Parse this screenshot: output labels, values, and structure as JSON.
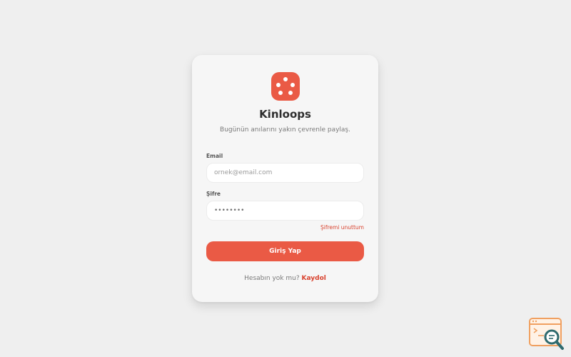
{
  "app": {
    "name": "Kinloops",
    "tagline": "Bugünün anılarını yakın çevrenle paylaş."
  },
  "form": {
    "email_label": "Email",
    "email_placeholder": "ornek@email.com",
    "password_label": "Şifre",
    "password_value": "••••••••",
    "forgot_label": "Şifremi unuttum",
    "submit_label": "Giriş Yap"
  },
  "signup": {
    "prompt": "Hesabın yok mu?",
    "link_label": "Kaydol"
  },
  "colors": {
    "accent": "#ea5a45",
    "link": "#d9432f",
    "background": "#efefef",
    "card": "#f6f6f6"
  },
  "icons": {
    "logo": "dice-icon",
    "corner": "code-search-icon"
  }
}
